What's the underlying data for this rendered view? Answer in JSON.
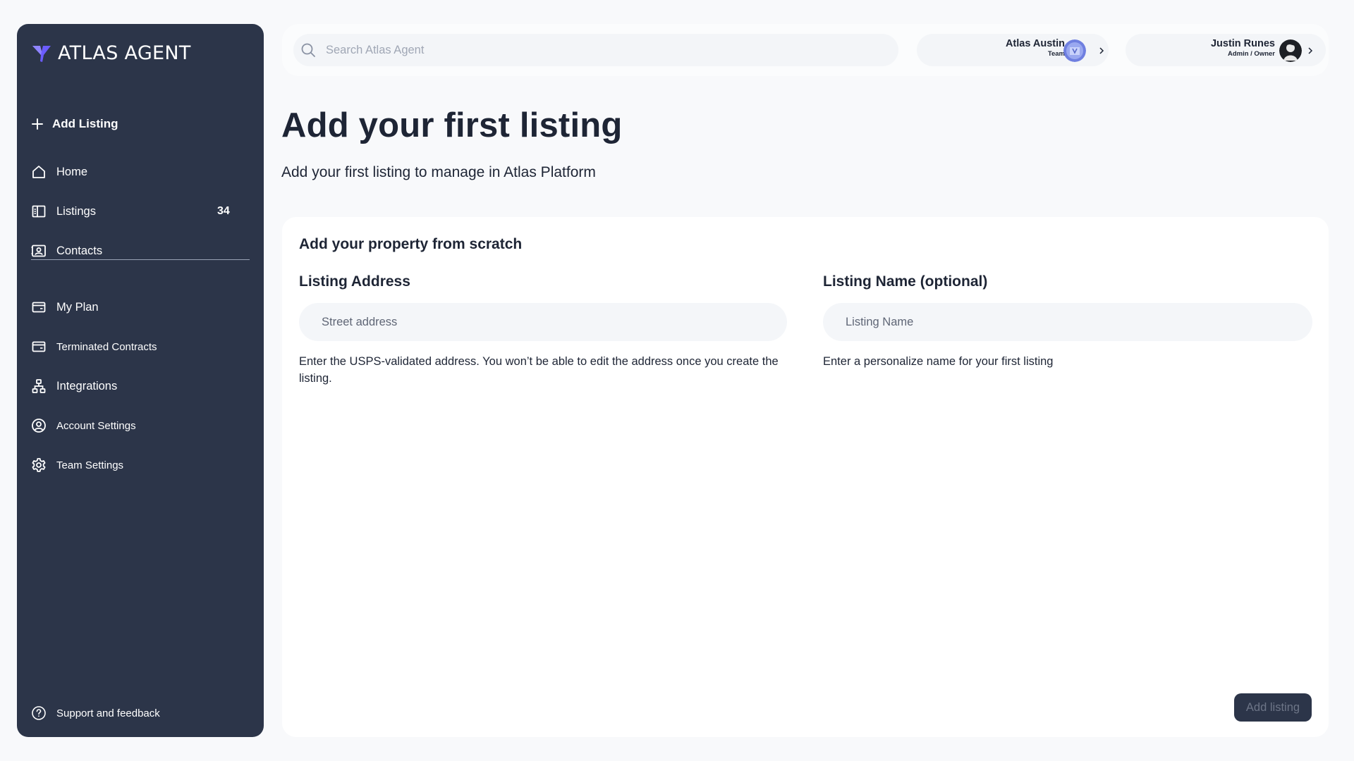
{
  "brand": {
    "name": "ATLAS AGENT",
    "accent": "#6b5cff"
  },
  "sidebar": {
    "add_listing": "Add Listing",
    "primary": [
      {
        "label": "Home",
        "icon": "home-icon"
      },
      {
        "label": "Listings",
        "icon": "listings-icon",
        "count": "34"
      },
      {
        "label": "Contacts",
        "icon": "contacts-icon"
      }
    ],
    "secondary": [
      {
        "label": "My Plan",
        "icon": "wallet-icon"
      },
      {
        "label": "Terminated Contracts",
        "icon": "wallet-icon"
      },
      {
        "label": "Integrations",
        "icon": "sitemap-icon"
      },
      {
        "label": "Account Settings",
        "icon": "user-circle-icon"
      },
      {
        "label": "Team Settings",
        "icon": "gear-icon"
      }
    ],
    "support": {
      "label": "Support and feedback",
      "icon": "help-circle-icon"
    },
    "background": "#2c3549"
  },
  "topbar": {
    "search_placeholder": "Search Atlas Agent",
    "team": {
      "name": "Atlas Austin",
      "role": "Team"
    },
    "user": {
      "name": "Justin Runes",
      "role": "Admin / Owner"
    }
  },
  "page": {
    "title": "Add your first listing",
    "subtitle": "Add your first listing to manage in Atlas Platform"
  },
  "form": {
    "heading": "Add your property from scratch",
    "address": {
      "label": "Listing Address",
      "placeholder": "Street address",
      "value": "",
      "help": "Enter the USPS-validated address. You won’t be able to edit the address once you create the listing."
    },
    "name": {
      "label": "Listing Name (optional)",
      "placeholder": "Listing Name",
      "value": "",
      "help": "Enter a personalize name for your first listing"
    },
    "submit_label": "Add listing"
  }
}
